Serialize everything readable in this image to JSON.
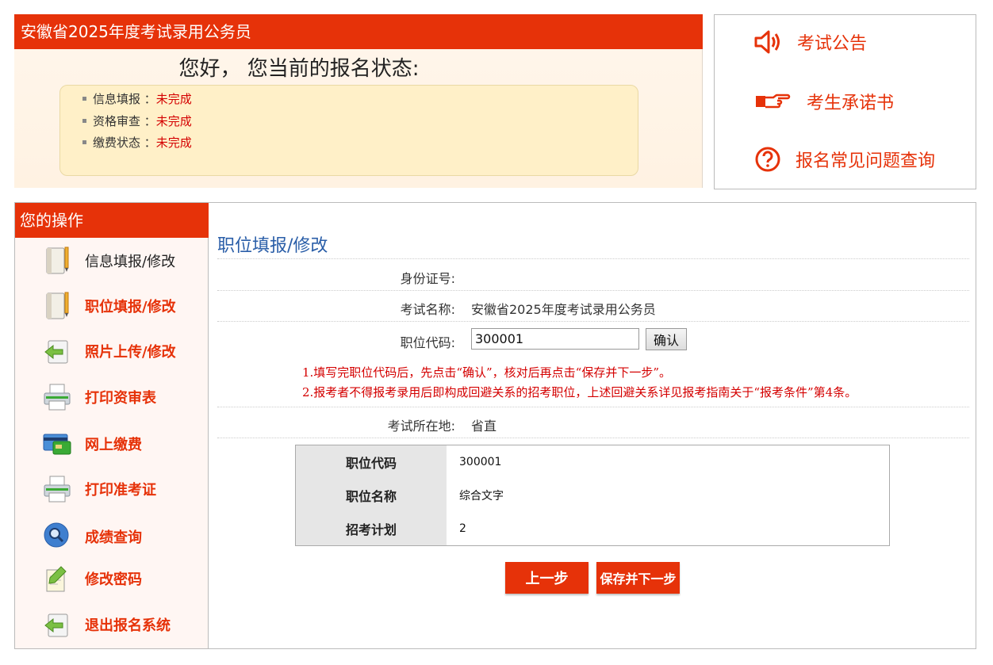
{
  "status": {
    "header": "安徽省2025年度考试录用公务员",
    "greeting": "您好， 您当前的报名状态:",
    "rows": [
      {
        "label": "信息填报 ：",
        "value": "未完成"
      },
      {
        "label": "资格审查 ：",
        "value": "未完成"
      },
      {
        "label": "缴费状态 ：",
        "value": "未完成"
      }
    ]
  },
  "notices": [
    {
      "label": "考试公告",
      "icon": "speaker-icon"
    },
    {
      "label": "考生承诺书",
      "icon": "pointing-hand-icon"
    },
    {
      "label": "报名常见问题查询",
      "icon": "question-icon"
    }
  ],
  "sidebar": {
    "title": "您的操作",
    "items": [
      {
        "label": "信息填报/修改",
        "icon": "notebook-icon"
      },
      {
        "label": "职位填报/修改",
        "icon": "notebook-icon"
      },
      {
        "label": "照片上传/修改",
        "icon": "upload-icon"
      },
      {
        "label": "打印资审表",
        "icon": "printer-icon"
      },
      {
        "label": "网上缴费",
        "icon": "credit-card-icon"
      },
      {
        "label": "打印准考证",
        "icon": "printer-icon"
      },
      {
        "label": "成绩查询",
        "icon": "magnifier-icon"
      },
      {
        "label": "修改密码",
        "icon": "pencil-icon"
      },
      {
        "label": "退出报名系统",
        "icon": "exit-icon"
      }
    ]
  },
  "form": {
    "title": "职位填报/修改",
    "id_label": "身份证号:",
    "exam_label": "考试名称:",
    "exam_value": "安徽省2025年度考试录用公务员",
    "code_label": "职位代码:",
    "code_value": "300001",
    "confirm": "确认",
    "note1": "1.填写完职位代码后，先点击“确认”，核对后再点击“保存并下一步”。",
    "note2": "2.报考者不得报考录用后即构成回避关系的招考职位，上述回避关系详见报考指南关于“报考条件”第4条。",
    "location_label": "考试所在地:",
    "location_value": "省直"
  },
  "position_table": [
    {
      "key": "职位代码",
      "value": "300001"
    },
    {
      "key": "职位名称",
      "value": "综合文字"
    },
    {
      "key": "招考计划",
      "value": "2"
    }
  ],
  "buttons": {
    "prev": "上一步",
    "save_next": "保存并下一步"
  }
}
